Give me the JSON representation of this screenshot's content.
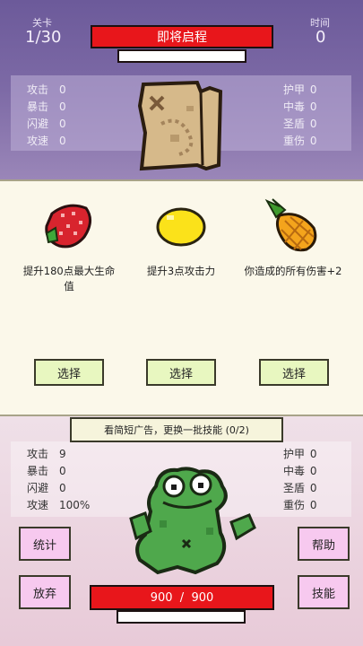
{
  "header": {
    "level_label": "关卡",
    "level_value": "1/30",
    "time_label": "时间",
    "time_value": "0",
    "banner_text": "即将启程"
  },
  "enemy": {
    "left_stats": [
      {
        "label": "攻击",
        "value": "0"
      },
      {
        "label": "暴击",
        "value": "0"
      },
      {
        "label": "闪避",
        "value": "0"
      },
      {
        "label": "攻速",
        "value": "0"
      }
    ],
    "right_stats": [
      {
        "label": "护甲",
        "value": "0"
      },
      {
        "label": "中毒",
        "value": "0"
      },
      {
        "label": "圣盾",
        "value": "0"
      },
      {
        "label": "重伤",
        "value": "0"
      }
    ],
    "icon": "treasure-map"
  },
  "choices": [
    {
      "icon": "strawberry",
      "desc": "提升180点最大生命值",
      "button": "选择"
    },
    {
      "icon": "lemon",
      "desc": "提升3点攻击力",
      "button": "选择"
    },
    {
      "icon": "pineapple",
      "desc": "你造成的所有伤害+2",
      "button": "选择"
    }
  ],
  "reroll_button": "看简短广告，更换一批技能 (0/2)",
  "player": {
    "left_stats": [
      {
        "label": "攻击",
        "value": "9"
      },
      {
        "label": "暴击",
        "value": "0"
      },
      {
        "label": "闪避",
        "value": "0"
      },
      {
        "label": "攻速",
        "value": "100%"
      }
    ],
    "right_stats": [
      {
        "label": "护甲",
        "value": "0"
      },
      {
        "label": "中毒",
        "value": "0"
      },
      {
        "label": "圣盾",
        "value": "0"
      },
      {
        "label": "重伤",
        "value": "0"
      }
    ],
    "hp_text": "900  /  900",
    "hp_fraction": 1.0,
    "icon": "frog"
  },
  "buttons": {
    "stats": "统计",
    "give_up": "放弃",
    "help": "帮助",
    "skills": "技能"
  }
}
